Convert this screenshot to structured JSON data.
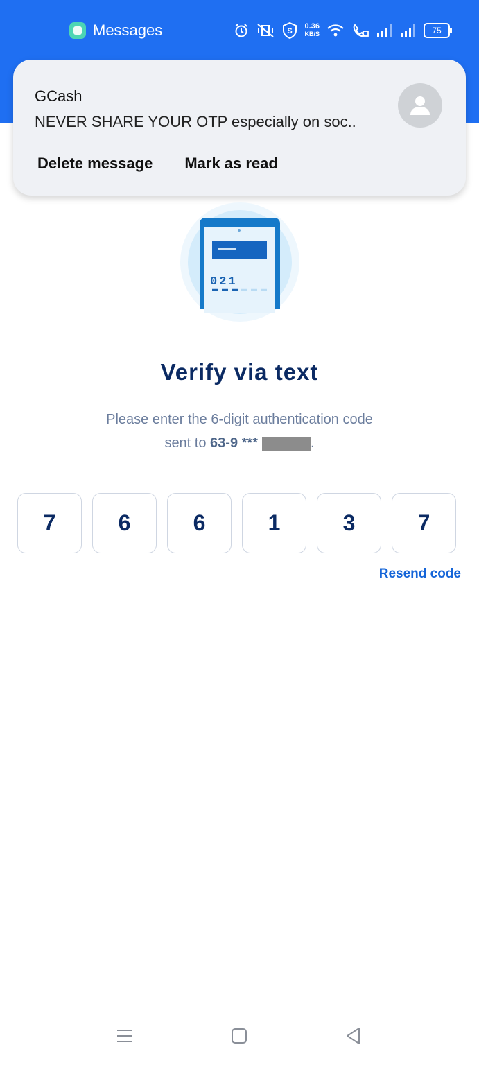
{
  "status_bar": {
    "app_name": "Messages",
    "net_speed_value": "0.36",
    "net_speed_unit": "KB/S",
    "battery_level": "75"
  },
  "notification": {
    "sender": "GCash",
    "body": "NEVER SHARE YOUR OTP especially on soc..",
    "actions": [
      {
        "label": "Delete message"
      },
      {
        "label": "Mark as read"
      }
    ]
  },
  "illustration": {
    "code_text": "021"
  },
  "verify": {
    "title": "Verify via text",
    "instruction_line1": "Please enter the 6-digit authentication code",
    "instruction_prefix": "sent to",
    "phone_masked": "63-9 ***",
    "instruction_suffix": "."
  },
  "otp": {
    "digits": [
      "7",
      "6",
      "6",
      "1",
      "3",
      "7"
    ]
  },
  "resend_label": "Resend code",
  "colors": {
    "header_blue": "#1f6ff2",
    "title_navy": "#0b2a63",
    "link_blue": "#1565d8"
  }
}
